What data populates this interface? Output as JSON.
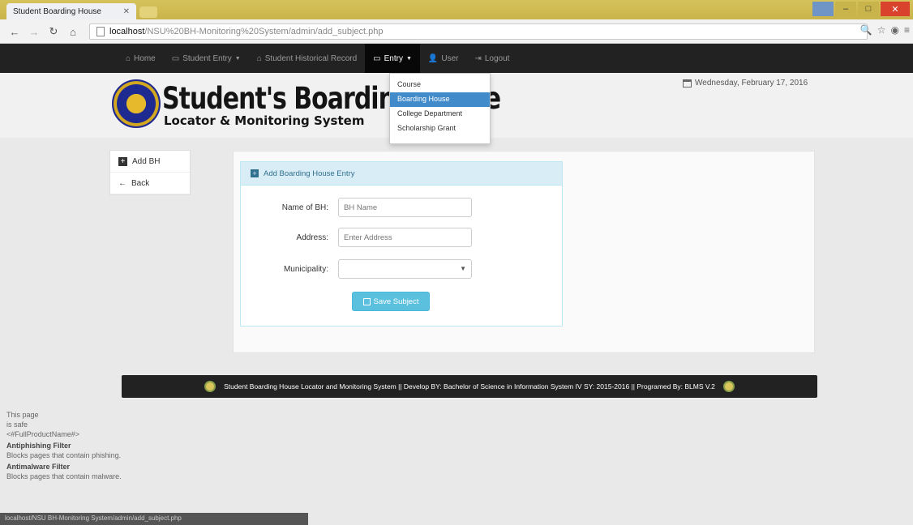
{
  "browser": {
    "tab_title": "Student Boarding House",
    "url_host": "localhost",
    "url_path": "/NSU%20BH-Monitoring%20System/admin/add_subject.php"
  },
  "nav": {
    "items": [
      {
        "label": "Home",
        "icon": "home-icon"
      },
      {
        "label": "Student Entry",
        "icon": "file-icon",
        "caret": true
      },
      {
        "label": "Student Historical Record",
        "icon": "home-icon"
      },
      {
        "label": "Entry",
        "icon": "file-icon",
        "caret": true,
        "active": true
      },
      {
        "label": "User",
        "icon": "user-icon"
      },
      {
        "label": "Logout",
        "icon": "logout-icon"
      }
    ]
  },
  "header": {
    "title": "Student's Boarding House",
    "subtitle": "Locator & Monitoring System",
    "date": "Wednesday, February 17, 2016"
  },
  "dropdown": {
    "items": [
      "Course",
      "Boarding House",
      "College Department",
      "Scholarship Grant"
    ],
    "selected": "Boarding House"
  },
  "sidemenu": {
    "add": "Add BH",
    "back": "Back"
  },
  "form": {
    "heading": "Add Boarding House Entry",
    "name_label": "Name of BH:",
    "name_placeholder": "BH Name",
    "address_label": "Address:",
    "address_placeholder": "Enter Address",
    "municipality_label": "Municipality:",
    "save_label": "Save Subject"
  },
  "footer": {
    "text": "Student Boarding House Locator and Monitoring System  ||  Develop BY: Bachelor of Science in Information System IV SY: 2015-2016  ||  Programed By: BLMS V.2"
  },
  "security": {
    "line1": "This page",
    "line2": "is safe",
    "line3": "<#FullProductName#>",
    "antiphishing_title": "Antiphishing Filter",
    "antiphishing_desc": "Blocks pages that contain phishing.",
    "antimalware_title": "Antimalware Filter",
    "antimalware_desc": "Blocks pages that contain malware."
  },
  "statusbar": "localhost/NSU BH-Monitoring System/admin/add_subject.php"
}
